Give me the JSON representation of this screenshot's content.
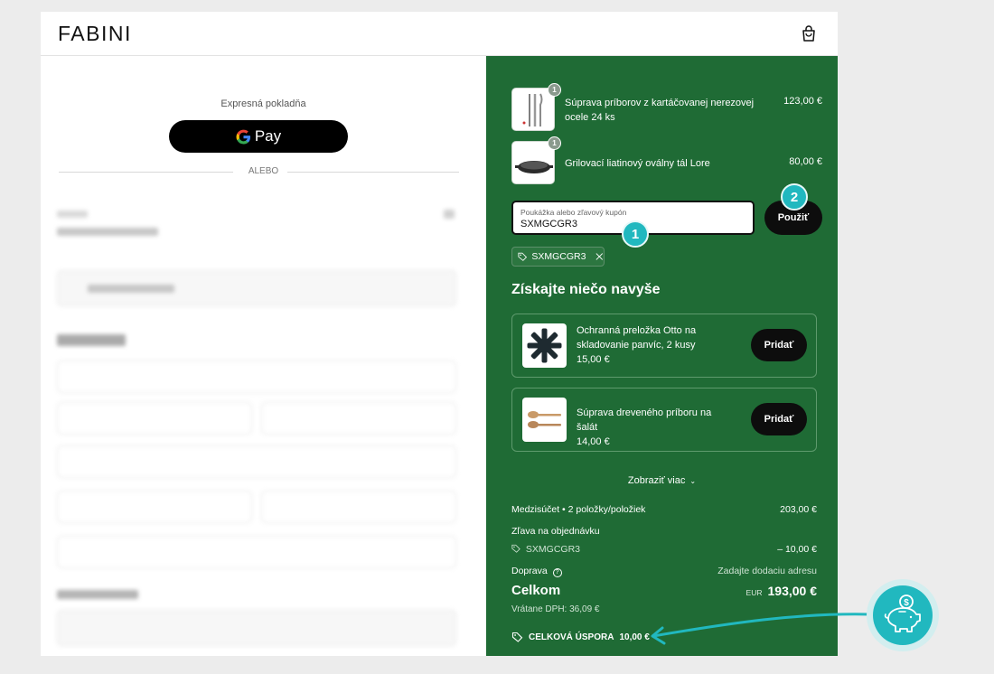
{
  "header": {
    "brand": "FABINI",
    "bag_icon": "shopping-bag-icon"
  },
  "left": {
    "express_label": "Expresná pokladňa",
    "gpay_label": "Pay",
    "divider_label": "ALEBO"
  },
  "order": {
    "items": [
      {
        "name": "Súprava príborov z kartáčovanej nerezovej ocele 24 ks",
        "price": "123,00 €",
        "qty": "1"
      },
      {
        "name": "Grilovací liatinový oválny tál Lore",
        "price": "80,00 €",
        "qty": "1"
      }
    ],
    "coupon": {
      "placeholder": "Poukážka alebo zľavový kupón",
      "value": "SXMGCGR3",
      "apply_label": "Použiť"
    },
    "applied_code": "SXMGCGR3",
    "extra_title": "Získajte niečo navyše",
    "upsells": [
      {
        "name": "Ochranná preložka Otto na skladovanie panvíc, 2 kusy",
        "price": "15,00 €",
        "button": "Pridať"
      },
      {
        "name": "Súprava dreveného príboru na šalát",
        "price": "14,00 €",
        "button": "Pridať"
      }
    ],
    "show_more": "Zobraziť viac",
    "subtotal_label": "Medzisúčet • 2 položky/položiek",
    "subtotal_value": "203,00 €",
    "discount_label": "Zľava na objednávku",
    "discount_code": "SXMGCGR3",
    "discount_value": "– 10,00 €",
    "shipping_label": "Doprava",
    "shipping_value": "Zadajte dodaciu adresu",
    "total_label": "Celkom",
    "total_currency": "EUR",
    "total_value": "193,00 €",
    "vat_note": "Vrátane DPH: 36,09 €",
    "savings_label": "CELKOVÁ ÚSPORA",
    "savings_value": "10,00 €"
  },
  "annotations": {
    "step1": "1",
    "step2": "2"
  },
  "colors": {
    "panel_green": "#1f6b35",
    "accent_teal": "#21b8bf",
    "button_black": "#0d0d0d"
  }
}
